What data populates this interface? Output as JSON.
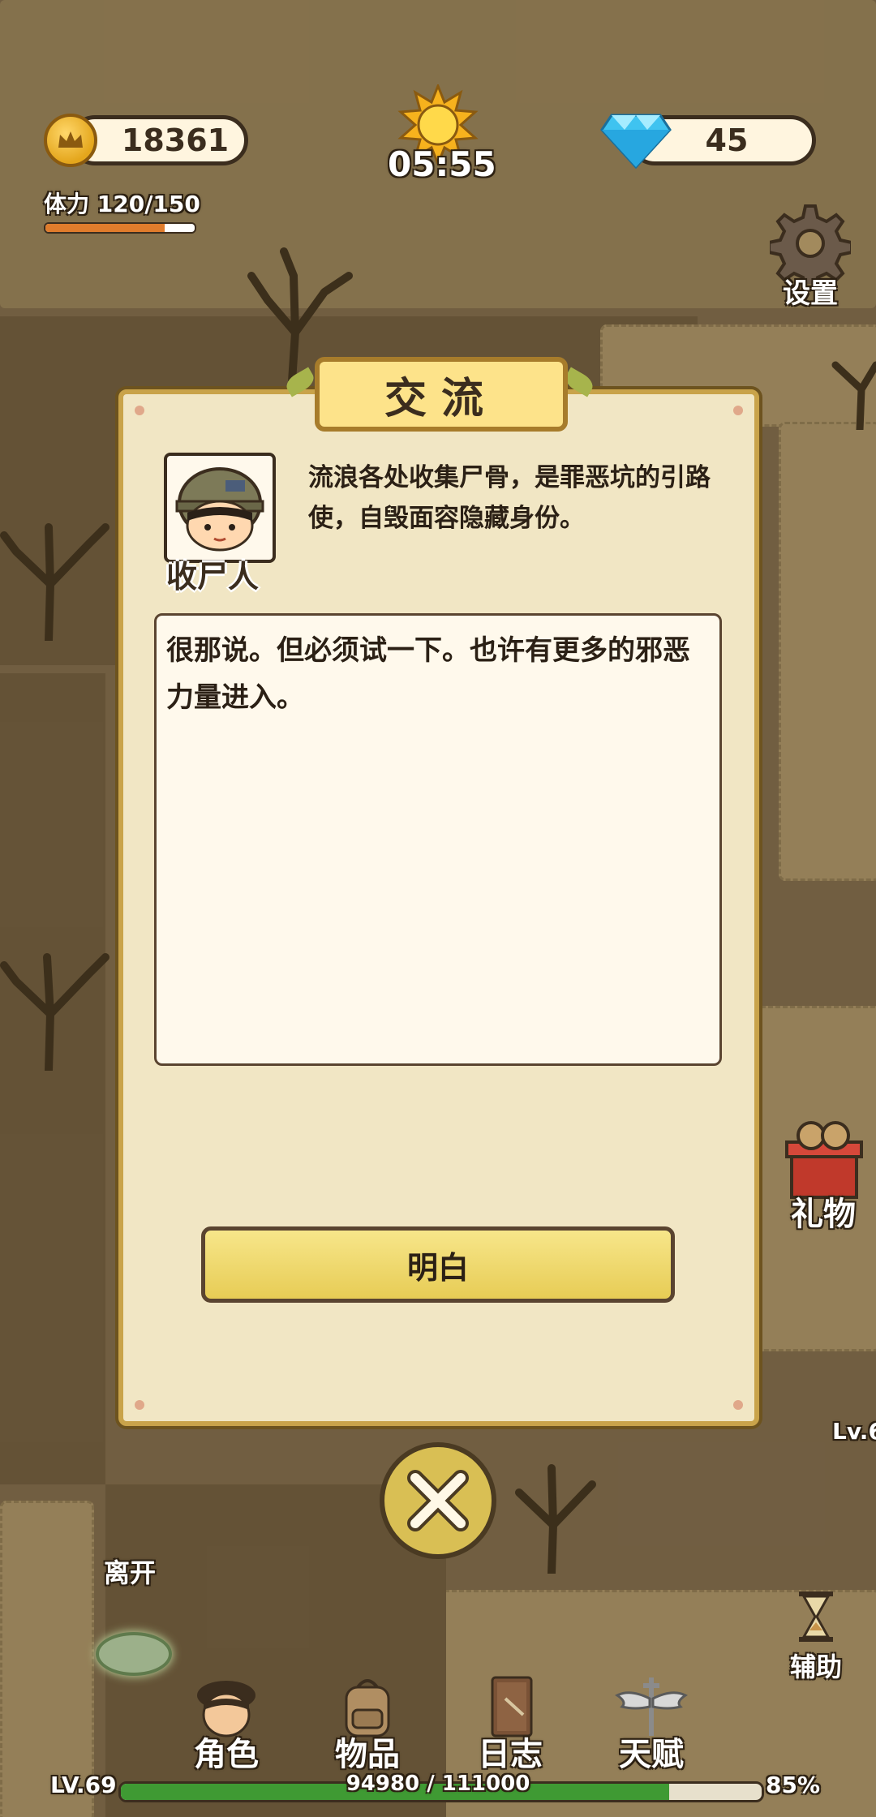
{
  "hud": {
    "gold": "18361",
    "clock": "05:55",
    "gems": "45",
    "stamina_label": "体力 120/150",
    "stamina_fraction": 0.8
  },
  "side_buttons": {
    "settings": "设置",
    "gift": "礼物",
    "assist": "辅助",
    "leave": "离开"
  },
  "map": {
    "enemy_level": "Lv.6"
  },
  "dialog": {
    "title": "交流",
    "npc_name": "收尸人",
    "npc_description": "流浪各处收集尸骨，是罪恶坑的引路使，自毁面容隐藏身份。",
    "message": "很那说。但必须试一下。也许有更多的邪恶力量进入。",
    "confirm_button": "明白"
  },
  "bottom_nav": [
    {
      "label": "角色",
      "icon": "character-icon"
    },
    {
      "label": "物品",
      "icon": "backpack-icon"
    },
    {
      "label": "日志",
      "icon": "journal-icon"
    },
    {
      "label": "天赋",
      "icon": "talent-wings-icon"
    }
  ],
  "progress": {
    "level": "LV.69",
    "xp_text": "94980 / 111000",
    "percent": "85%",
    "xp_fraction": 0.8557
  },
  "colors": {
    "panel_bg": "#f1e6c4",
    "panel_border": "#c9a34a",
    "button_yellow": "#e7cc55",
    "xp_green": "#3f9a33",
    "ground": "#8a7350"
  }
}
